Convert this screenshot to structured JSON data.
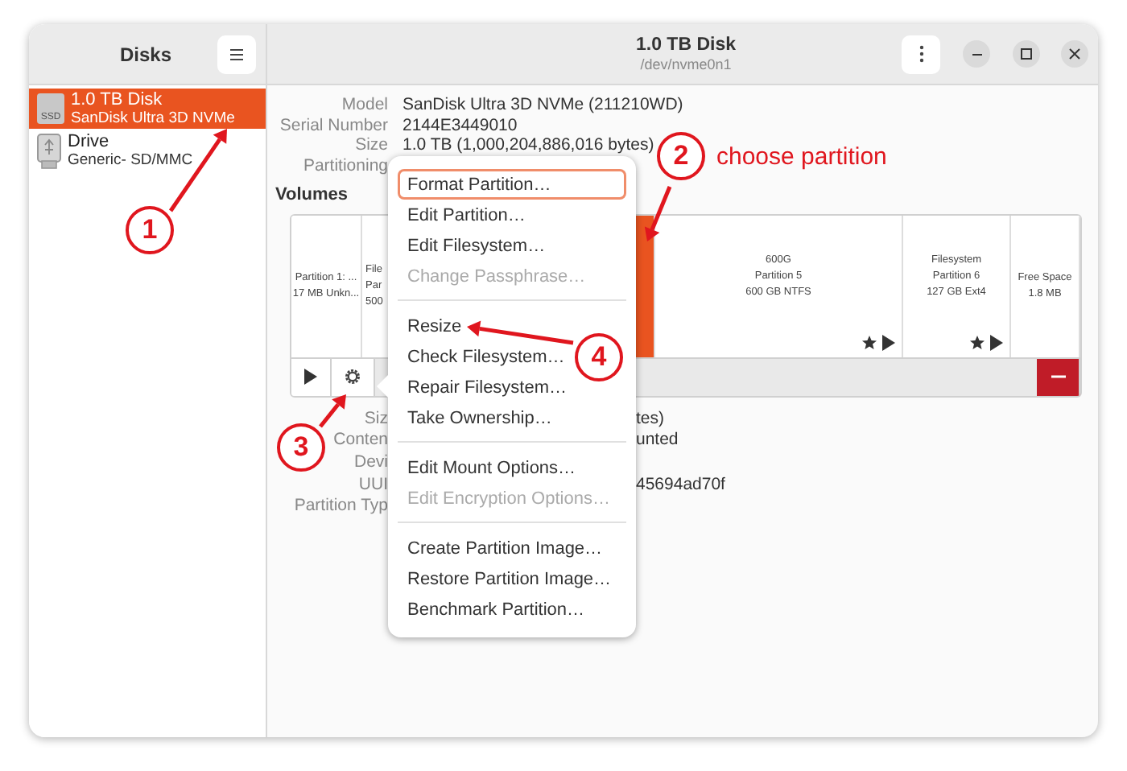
{
  "sidebar": {
    "title": "Disks",
    "items": [
      {
        "name": "1.0 TB Disk",
        "detail": "SanDisk Ultra 3D NVMe",
        "kind": "ssd",
        "badge": "SSD",
        "selected": true
      },
      {
        "name": "Drive",
        "detail": "Generic- SD/MMC",
        "kind": "usb",
        "selected": false
      }
    ]
  },
  "header": {
    "title": "1.0 TB Disk",
    "subtitle": "/dev/nvme0n1"
  },
  "disk_info": [
    {
      "label": "Model",
      "value": "SanDisk Ultra 3D NVMe (211210WD)"
    },
    {
      "label": "Serial Number",
      "value": "2144E3449010"
    },
    {
      "label": "Size",
      "value": "1.0 TB (1,000,204,886,016 bytes)"
    },
    {
      "label": "Partitioning"
    }
  ],
  "volumes": {
    "title": "Volumes",
    "segments": [
      {
        "lines": [
          "Partition 1: ...",
          "17 MB Unkn..."
        ],
        "selected": false,
        "mounted": false
      },
      {
        "lines": [
          "File",
          "Par",
          "500"
        ],
        "selected": false,
        "mounted": false
      },
      {
        "selected": true,
        "mounted": false
      },
      {
        "lines": [
          "600G",
          "Partition 5",
          "600 GB NTFS"
        ],
        "selected": false,
        "mounted": true
      },
      {
        "lines": [
          "Filesystem",
          "Partition 6",
          "127 GB Ext4"
        ],
        "selected": false,
        "mounted": true
      },
      {
        "lines": [
          "Free Space",
          "1.8 MB"
        ],
        "selected": false,
        "mounted": false
      }
    ]
  },
  "partition_info": [
    {
      "label": "Siz",
      "value": "tes)"
    },
    {
      "label": "Conten",
      "value": "unted"
    },
    {
      "label": "Devi"
    },
    {
      "label": "UUI",
      "value": "45694ad70f"
    },
    {
      "label": "Partition Typ"
    }
  ],
  "menu": {
    "items": [
      {
        "kind": "item",
        "label": "Format Partition…",
        "selected": true,
        "disabled": false
      },
      {
        "kind": "item",
        "label": "Edit Partition…",
        "selected": false,
        "disabled": false
      },
      {
        "kind": "item",
        "label": "Edit Filesystem…",
        "selected": false,
        "disabled": false
      },
      {
        "kind": "item",
        "label": "Change Passphrase…",
        "selected": false,
        "disabled": true
      },
      {
        "kind": "separator"
      },
      {
        "kind": "item",
        "label": "Resize",
        "selected": false,
        "disabled": false
      },
      {
        "kind": "item",
        "label": "Check Filesystem…",
        "selected": false,
        "disabled": false
      },
      {
        "kind": "item",
        "label": "Repair Filesystem…",
        "selected": false,
        "disabled": false
      },
      {
        "kind": "item",
        "label": "Take Ownership…",
        "selected": false,
        "disabled": false
      },
      {
        "kind": "separator"
      },
      {
        "kind": "item",
        "label": "Edit Mount Options…",
        "selected": false,
        "disabled": false
      },
      {
        "kind": "item",
        "label": "Edit Encryption Options…",
        "selected": false,
        "disabled": true
      },
      {
        "kind": "separator"
      },
      {
        "kind": "item",
        "label": "Create Partition Image…",
        "selected": false,
        "disabled": false
      },
      {
        "kind": "item",
        "label": "Restore Partition Image…",
        "selected": false,
        "disabled": false
      },
      {
        "kind": "item",
        "label": "Benchmark Partition…",
        "selected": false,
        "disabled": false
      }
    ]
  },
  "annotations": [
    {
      "number": "1"
    },
    {
      "number": "2",
      "caption": "choose partition"
    },
    {
      "number": "3"
    },
    {
      "number": "4"
    }
  ]
}
